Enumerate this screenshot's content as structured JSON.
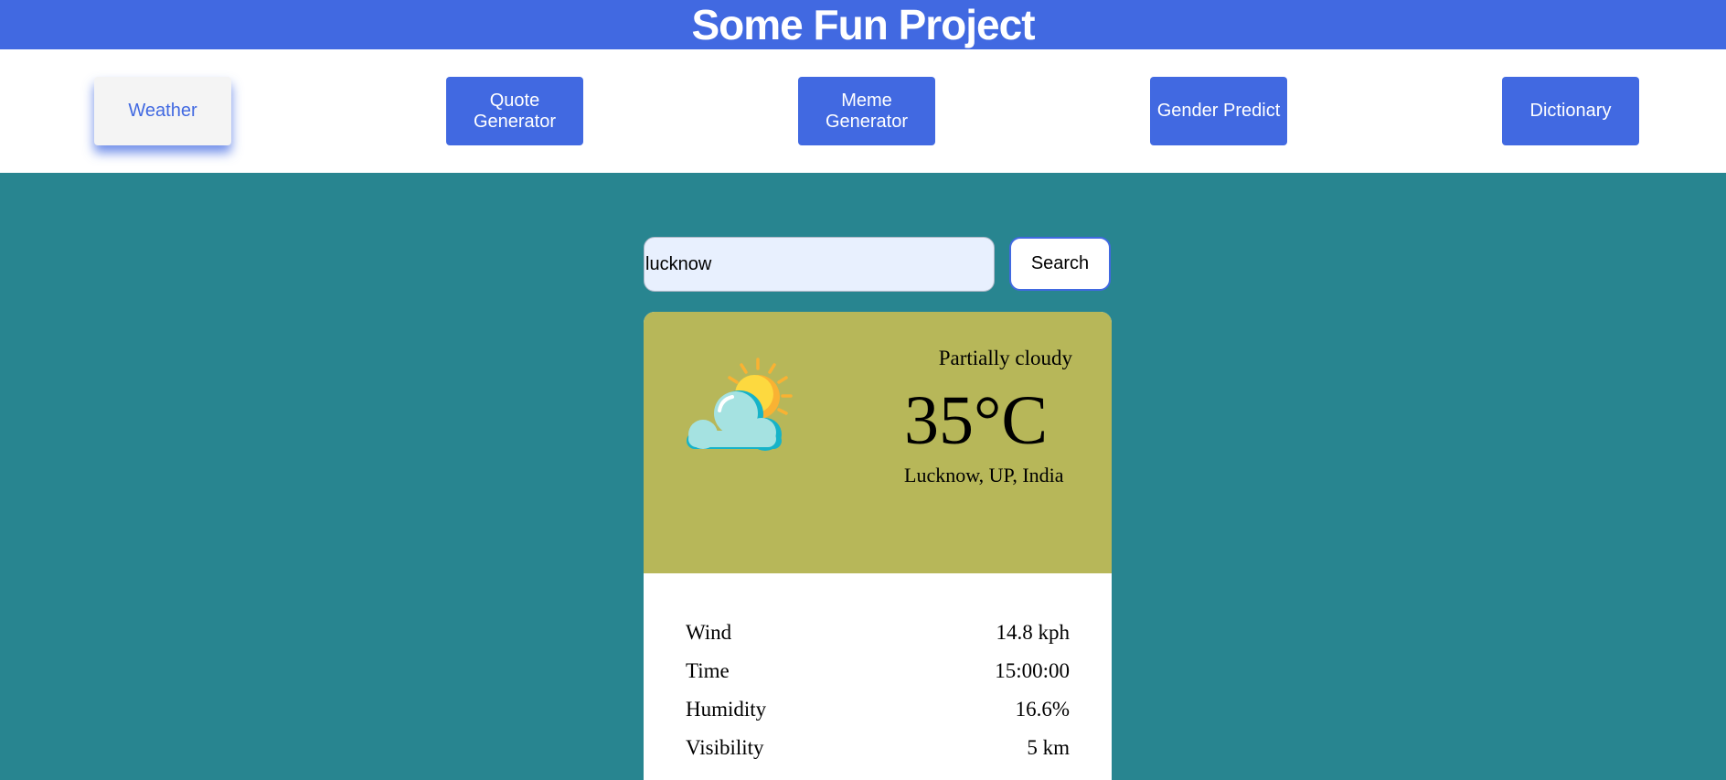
{
  "header": {
    "title": "Some Fun Project"
  },
  "nav": {
    "items": [
      {
        "label": "Weather",
        "active": true
      },
      {
        "label": "Quote Generator",
        "active": false
      },
      {
        "label": "Meme Generator",
        "active": false
      },
      {
        "label": "Gender Predict",
        "active": false
      },
      {
        "label": "Dictionary",
        "active": false
      }
    ]
  },
  "search": {
    "value": "lucknow",
    "button_label": "Search"
  },
  "weather": {
    "icon": "partly-cloudy-icon",
    "condition": "Partially cloudy",
    "temperature": "35°C",
    "location": "Lucknow, UP, India",
    "details": [
      {
        "label": "Wind",
        "value": "14.8 kph"
      },
      {
        "label": "Time",
        "value": "15:00:00"
      },
      {
        "label": "Humidity",
        "value": "16.6%"
      },
      {
        "label": "Visibility",
        "value": "5 km"
      }
    ]
  },
  "colors": {
    "primary": "#4169e1",
    "background": "#288590",
    "card_top": "#b7b759",
    "active_button": "#f4f4f4"
  }
}
